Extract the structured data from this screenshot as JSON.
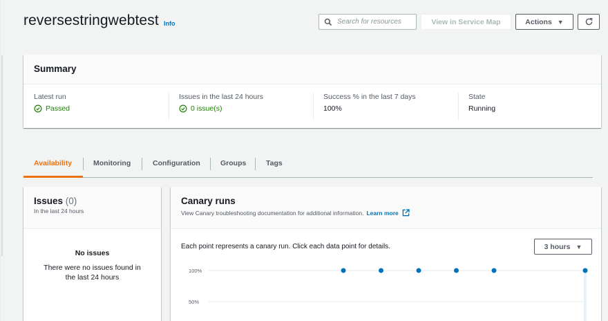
{
  "header": {
    "title": "reversestringwebtest",
    "info_label": "Info",
    "search_placeholder": "Search for resources",
    "view_map_label": "View in Service Map",
    "actions_label": "Actions",
    "refresh_icon": "refresh-icon"
  },
  "summary": {
    "title": "Summary",
    "columns": [
      {
        "label": "Latest run",
        "value": "Passed",
        "status": "success"
      },
      {
        "label": "Issues in the last 24 hours",
        "value": "0 issue(s)",
        "status": "success"
      },
      {
        "label": "Success % in the last 7 days",
        "value": "100%"
      },
      {
        "label": "State",
        "value": "Running"
      }
    ]
  },
  "tabs": [
    {
      "label": "Availability",
      "active": true
    },
    {
      "label": "Monitoring"
    },
    {
      "label": "Configuration"
    },
    {
      "label": "Groups"
    },
    {
      "label": "Tags"
    }
  ],
  "issues_panel": {
    "title": "Issues",
    "count": "(0)",
    "subtitle": "In the last 24 hours",
    "empty_title": "No issues",
    "empty_text": "There were no issues found in the last 24 hours"
  },
  "runs_panel": {
    "title": "Canary runs",
    "subtitle": "View Canary troubleshooting documentation for additional information.",
    "learn_more": "Learn more",
    "description": "Each point represents a canary run. Click each data point for details.",
    "time_range": "3 hours"
  },
  "colors": {
    "accent": "#ec7211",
    "link": "#0073bb",
    "success": "#1d8102",
    "point": "#0073bb"
  },
  "chart_data": {
    "type": "scatter",
    "y_tick_labels": [
      "100%",
      "50%"
    ],
    "series": [
      {
        "values": [
          100,
          100,
          100,
          100,
          100,
          100
        ]
      }
    ],
    "point_positions_relative": [
      0.379,
      0.481,
      0.583,
      0.685,
      0.787,
      1.0
    ],
    "grid": true
  }
}
